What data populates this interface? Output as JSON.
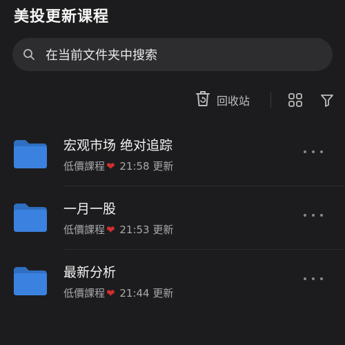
{
  "header": {
    "title": "美投更新课程"
  },
  "search": {
    "placeholder": "在当前文件夹中搜索",
    "icon": "search-icon"
  },
  "toolbar": {
    "recycle_label": "回收站",
    "icons": [
      "recycle-bin-icon",
      "grid-view-icon",
      "filter-icon"
    ]
  },
  "colors": {
    "background": "#1c1c1e",
    "search_bg": "#2d2d30",
    "folder_blue": "#3b82e0",
    "heart_red": "#d32f2f"
  },
  "folders": [
    {
      "name": "宏观市场 绝对追踪",
      "owner": "低價課程",
      "time": "21:58",
      "status": "更新"
    },
    {
      "name": "一月一股",
      "owner": "低價課程",
      "time": "21:53",
      "status": "更新"
    },
    {
      "name": "最新分析",
      "owner": "低價課程",
      "time": "21:44",
      "status": "更新"
    }
  ]
}
